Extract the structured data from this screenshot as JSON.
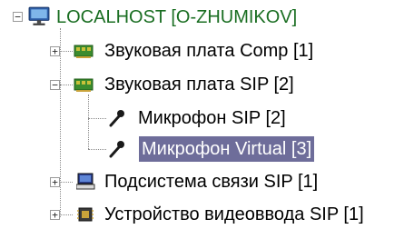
{
  "tree": {
    "root": {
      "label": "LOCALHOST [O-ZHUMIKOV]",
      "icon": "computer-monitor-icon",
      "expander": "−"
    },
    "items": [
      {
        "label": "Звуковая плата Comp [1]",
        "icon": "sound-card-icon",
        "expander": "+"
      },
      {
        "label": "Звуковая плата SIP [2]",
        "icon": "sound-card-icon",
        "expander": "−"
      },
      {
        "label": "Микрофон SIP [2]",
        "icon": "microphone-icon"
      },
      {
        "label": "Микрофон Virtual [3]",
        "icon": "microphone-icon",
        "selected": true
      },
      {
        "label": "Подсистема связи SIP [1]",
        "icon": "computer-icon",
        "expander": "+"
      },
      {
        "label": "Устройство видеоввода SIP [1]",
        "icon": "video-chip-icon",
        "expander": "+"
      }
    ]
  },
  "colors": {
    "root_text": "#1a6e22",
    "selection_bg": "#6e6d9a",
    "selection_text": "#ffffff",
    "tree_lines": "#8a8a8a"
  }
}
